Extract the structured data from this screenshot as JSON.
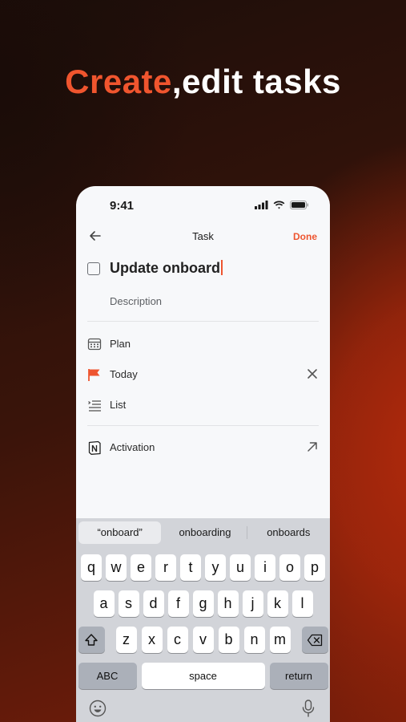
{
  "headline": {
    "accent": "Create",
    "rest": ",edit tasks"
  },
  "status_bar": {
    "time": "9:41"
  },
  "nav": {
    "title": "Task",
    "done_label": "Done"
  },
  "task": {
    "title": "Update onboard",
    "description_placeholder": "Description"
  },
  "options": [
    {
      "label": "Plan",
      "icon": "calendar-icon"
    },
    {
      "label": "Today",
      "icon": "flag-icon",
      "trailing": "close-icon"
    },
    {
      "label": "List",
      "icon": "list-icon"
    }
  ],
  "integration": {
    "label": "Activation",
    "icon": "notion-icon",
    "trailing": "arrow-up-right-icon"
  },
  "keyboard": {
    "suggestions": [
      "“onboard”",
      "onboarding",
      "onboards"
    ],
    "row1": [
      "q",
      "w",
      "e",
      "r",
      "t",
      "y",
      "u",
      "i",
      "o",
      "p"
    ],
    "row2": [
      "a",
      "s",
      "d",
      "f",
      "g",
      "h",
      "j",
      "k",
      "l"
    ],
    "row3": [
      "z",
      "x",
      "c",
      "v",
      "b",
      "n",
      "m"
    ],
    "abc_label": "ABC",
    "space_label": "space",
    "return_label": "return"
  },
  "colors": {
    "accent": "#ee5530",
    "headline_accent": "#f0552e"
  }
}
